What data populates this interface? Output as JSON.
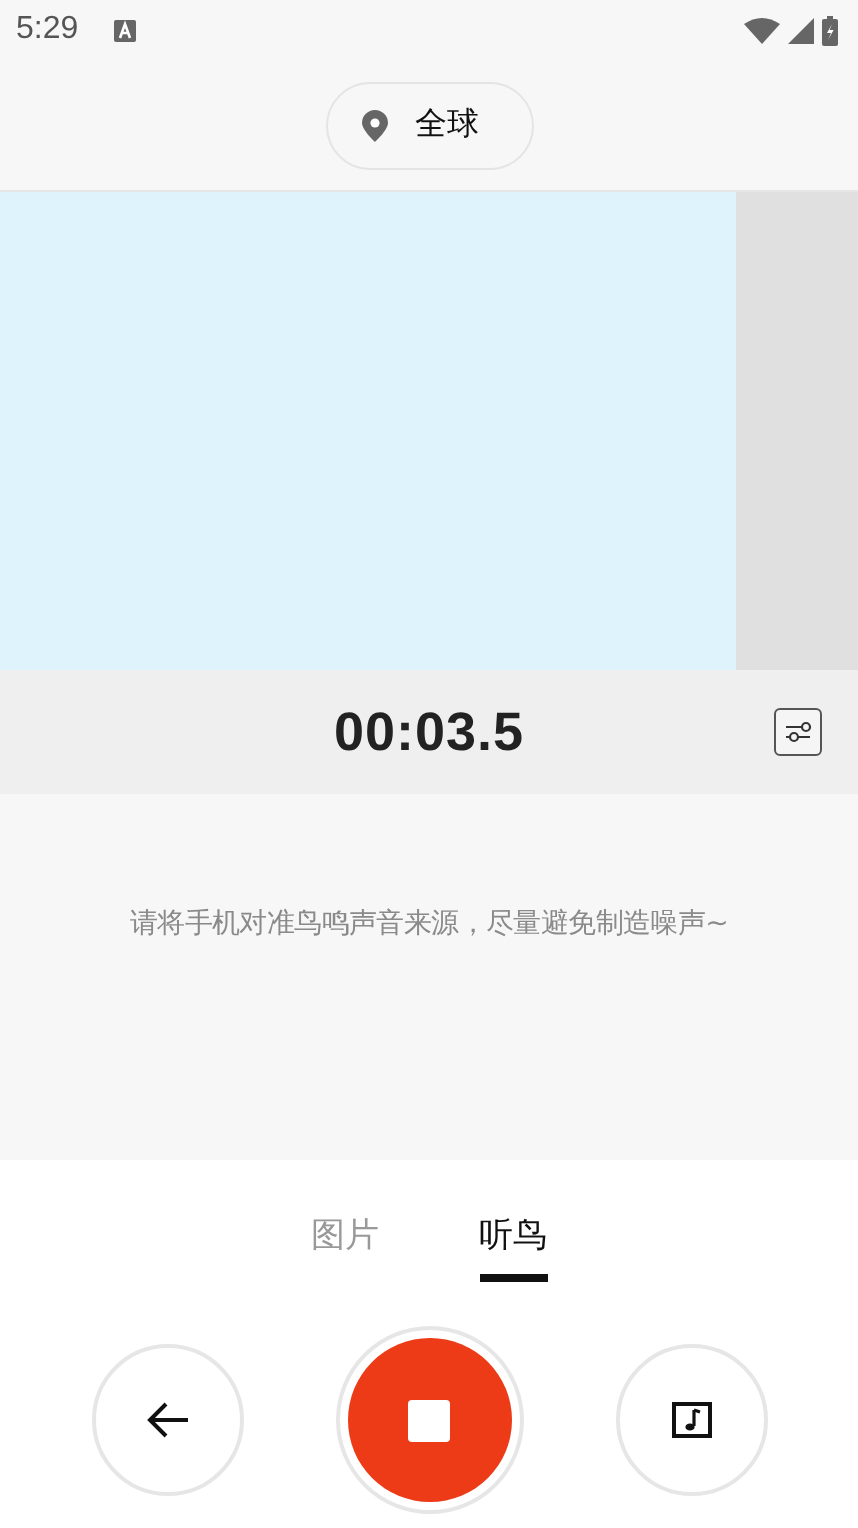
{
  "status_bar": {
    "time": "5:29"
  },
  "location": {
    "label": "全球"
  },
  "timer": {
    "elapsed": "00:03.5"
  },
  "hint": "请将手机对准鸟鸣声音来源，尽量避免制造噪声~",
  "tabs": [
    {
      "label": "图片",
      "selected": false
    },
    {
      "label": "听鸟",
      "selected": true
    }
  ],
  "recording": true
}
